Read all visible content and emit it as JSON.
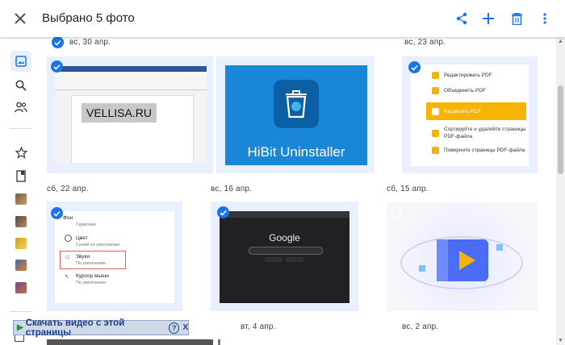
{
  "header": {
    "title": "Выбрано 5 фото"
  },
  "dates": {
    "d1": "вс, 30 апр.",
    "d2": "вс, 23 апр.",
    "d3": "сб, 22 апр.",
    "d4": "вс, 16 апр.",
    "d5": "сб, 15 апр.",
    "d6": "вт, 4 апр.",
    "d7": "вс, 2 апр."
  },
  "photos": {
    "vellisa": {
      "text": "VELLISA.RU"
    },
    "hibit": {
      "text": "HiBit Uninstaller"
    },
    "pdf_menu": {
      "items": [
        "Редактировать PDF",
        "Объединить PDF",
        "Разделить PDF",
        "Сортируйте и удаляйте страницы PDF-файла",
        "Поверните страницы PDF-файла"
      ]
    },
    "settings": {
      "items": [
        {
          "title": "Фон",
          "sub": "Гармония"
        },
        {
          "title": "Цвет",
          "sub": "Синий по умолчанию"
        },
        {
          "title": "Звуки",
          "sub": "По умолчанию"
        },
        {
          "title": "Курсор мыши",
          "sub": "По умолчанию"
        }
      ]
    },
    "google": {
      "logo": "Google"
    }
  },
  "download_bar": {
    "label": "Скачать видео с этой страницы",
    "help": "?",
    "close": "X"
  },
  "colors": {
    "accent": "#1a73e8",
    "tile_selected": "#e8f0fe",
    "pdf_highlight": "#f4b400"
  }
}
